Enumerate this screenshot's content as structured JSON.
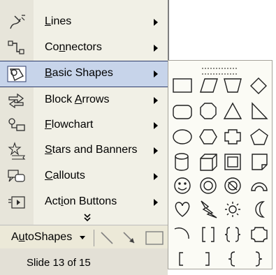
{
  "menu": {
    "items": [
      {
        "pre": "",
        "key": "L",
        "post": "ines",
        "icon": "lines-icon"
      },
      {
        "pre": "Co",
        "key": "n",
        "post": "nectors",
        "icon": "connectors-icon"
      },
      {
        "pre": "",
        "key": "B",
        "post": "asic Shapes",
        "icon": "basic-shapes-icon"
      },
      {
        "pre": "Block ",
        "key": "A",
        "post": "rrows",
        "icon": "block-arrows-icon"
      },
      {
        "pre": "",
        "key": "F",
        "post": "lowchart",
        "icon": "flowchart-icon"
      },
      {
        "pre": "",
        "key": "S",
        "post": "tars and Banners",
        "icon": "stars-banners-icon"
      },
      {
        "pre": "",
        "key": "C",
        "post": "allouts",
        "icon": "callouts-icon"
      },
      {
        "pre": "Act",
        "key": "i",
        "post": "on Buttons",
        "icon": "action-buttons-icon"
      }
    ],
    "selected_index": 2,
    "more_glyph": "¥"
  },
  "toolbar": {
    "autoshapes_pre": "A",
    "autoshapes_key": "u",
    "autoshapes_post": "toShapes"
  },
  "status": {
    "slide_text": "Slide 13 of 15"
  },
  "palette": {
    "shapes": [
      "rectangle-icon",
      "parallelogram-icon",
      "trapezoid-icon",
      "diamond-icon",
      "rounded-rectangle-icon",
      "octagon-icon",
      "triangle-icon",
      "right-triangle-icon",
      "oval-icon",
      "hexagon-icon",
      "cross-icon",
      "pentagon-icon",
      "can-icon",
      "cube-icon",
      "bevel-icon",
      "folded-corner-icon",
      "smiley-face-icon",
      "donut-icon",
      "no-symbol-icon",
      "block-arc-icon",
      "heart-icon",
      "lightning-bolt-icon",
      "sun-icon",
      "moon-icon",
      "arc-icon",
      "double-bracket-icon",
      "double-brace-icon",
      "plaque-icon",
      "left-bracket-icon",
      "right-bracket-icon",
      "left-brace-icon",
      "right-brace-icon"
    ]
  },
  "colors": {
    "menu_bg": "#f1f0e6",
    "selection": "#c7d4ea",
    "selection_border": "#2f3d6b",
    "status_bg": "#e3e0d6"
  }
}
